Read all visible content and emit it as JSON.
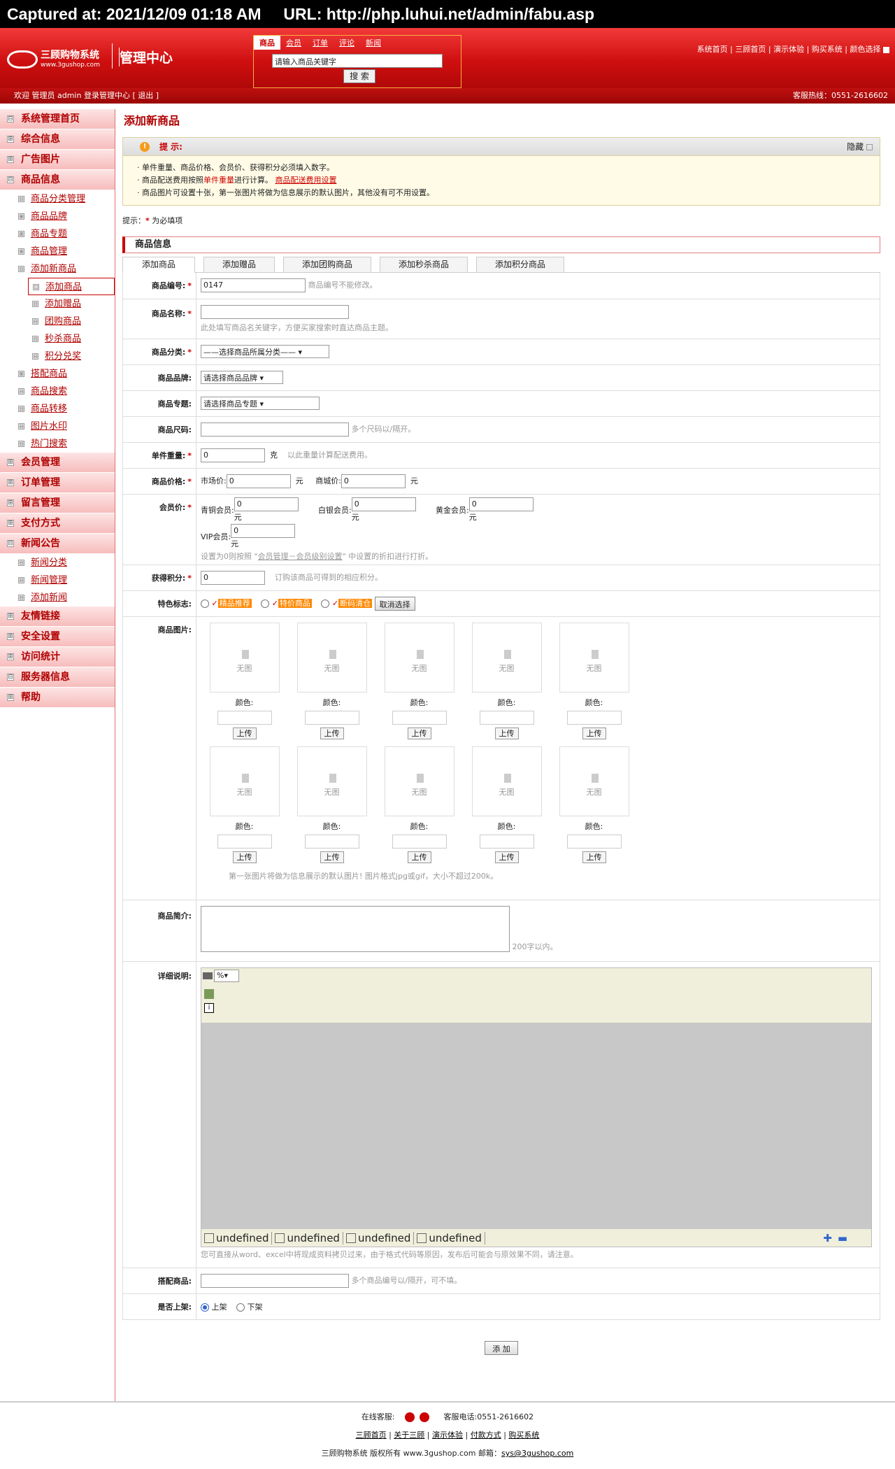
{
  "capture": {
    "text": "Captured at: 2021/12/09 01:18 AM     URL: http://php.luhui.net/admin/fabu.asp"
  },
  "header": {
    "brand_cn": "三顾购物系统",
    "brand_en": "www.3gushop.com",
    "title": "管理中心",
    "search_tabs": [
      "商品",
      "会员",
      "订单",
      "评论",
      "新闻"
    ],
    "search_placeholder": "请输入商品关键字",
    "search_button": "搜 索",
    "top_links": [
      "系统首页",
      "三顾首页",
      "演示体验",
      "购买系统",
      "颜色选择"
    ]
  },
  "status_bar": {
    "welcome": "欢迎 管理员 admin 登录管理中心 [ 退出 ]",
    "hotline": "客服热线：0551-2616602"
  },
  "sidebar": {
    "items": [
      {
        "label": "系统管理首页",
        "type": "main",
        "icon": "⊟"
      },
      {
        "label": "综合信息",
        "type": "main",
        "icon": "⊞"
      },
      {
        "label": "广告图片",
        "type": "main",
        "icon": "⊞"
      },
      {
        "label": "商品信息",
        "type": "main",
        "icon": "⊟"
      },
      {
        "label": "商品分类管理",
        "type": "sub",
        "icon": "⊟"
      },
      {
        "label": "商品品牌",
        "type": "sub",
        "icon": "⊞"
      },
      {
        "label": "商品专题",
        "type": "sub",
        "icon": "⊞"
      },
      {
        "label": "商品管理",
        "type": "sub",
        "icon": "⊞"
      },
      {
        "label": "添加新商品",
        "type": "sub",
        "icon": "⊟"
      },
      {
        "label": "添加商品",
        "type": "sel",
        "icon": "⊡"
      },
      {
        "label": "添加赠品",
        "type": "l3",
        "icon": "⊟"
      },
      {
        "label": "团购商品",
        "type": "l3",
        "icon": "⊟"
      },
      {
        "label": "秒杀商品",
        "type": "l3",
        "icon": "⊟"
      },
      {
        "label": "积分兑奖",
        "type": "l3",
        "icon": "⊟"
      },
      {
        "label": "搭配商品",
        "type": "sub",
        "icon": "⊞"
      },
      {
        "label": "商品搜索",
        "type": "sub",
        "icon": "⊟"
      },
      {
        "label": "商品转移",
        "type": "sub",
        "icon": "⊟"
      },
      {
        "label": "图片水印",
        "type": "sub",
        "icon": "⊟"
      },
      {
        "label": "热门搜索",
        "type": "sub",
        "icon": "⊟"
      },
      {
        "label": "会员管理",
        "type": "main",
        "icon": "⊞"
      },
      {
        "label": "订单管理",
        "type": "main",
        "icon": "⊞"
      },
      {
        "label": "留言管理",
        "type": "main",
        "icon": "⊞"
      },
      {
        "label": "支付方式",
        "type": "main",
        "icon": "⊞"
      },
      {
        "label": "新闻公告",
        "type": "main",
        "icon": "⊟"
      },
      {
        "label": "新闻分类",
        "type": "sub",
        "icon": "⊟"
      },
      {
        "label": "新闻管理",
        "type": "sub",
        "icon": "⊟"
      },
      {
        "label": "添加新闻",
        "type": "sub",
        "icon": "⊟"
      },
      {
        "label": "友情链接",
        "type": "main",
        "icon": "⊞"
      },
      {
        "label": "安全设置",
        "type": "main",
        "icon": "⊞"
      },
      {
        "label": "访问统计",
        "type": "main",
        "icon": "⊞"
      },
      {
        "label": "服务器信息",
        "type": "main",
        "icon": "⊟"
      },
      {
        "label": "帮助",
        "type": "main",
        "icon": "⊞"
      }
    ]
  },
  "main": {
    "page_title": "添加新商品",
    "tip": {
      "title": "提 示:",
      "hide": "隐藏",
      "line1": "· 单件重量、商品价格、会员价、获得积分必须填入数字。",
      "line2_a": "· 商品配送费用按照",
      "line2_b": "单件重量",
      "line2_c": "进行计算。",
      "line2_link": "商品配送费用设置",
      "line3": "· 商品图片可设置十张，第一张图片将做为信息展示的默认图片，其他没有可不用设置。"
    },
    "required_note_a": "提示：",
    "required_note_star": "*",
    "required_note_b": " 为必填项",
    "section": "商品信息",
    "tabs": [
      "添加商品",
      "添加赠品",
      "添加团购商品",
      "添加秒杀商品",
      "添加积分商品"
    ],
    "fields": {
      "code_label": "商品编号:",
      "code_value": "0147",
      "code_hint": "商品编号不能修改。",
      "name_label": "商品名称:",
      "name_hint": "此处填写商品名关键字，方便买家搜索时直达商品主题。",
      "cat_label": "商品分类:",
      "cat_value": "——选择商品所属分类——",
      "brand_label": "商品品牌:",
      "brand_value": "请选择商品品牌",
      "topic_label": "商品专题:",
      "topic_value": "请选择商品专题",
      "size_label": "商品尺码:",
      "size_hint": "多个尺码以/隔开。",
      "weight_label": "单件重量:",
      "weight_value": "0",
      "weight_unit": "克",
      "weight_hint": "以此重量计算配送费用。",
      "price_label": "商品价格:",
      "market_label": "市场价:",
      "market_value": "0",
      "yuan": "元",
      "shop_label": "商城价:",
      "shop_value": "0",
      "member_label": "会员价:",
      "m1_label": "青铜会员:",
      "m1_value": "0",
      "m2_label": "白银会员:",
      "m2_value": "0",
      "m3_label": "黄金会员:",
      "m3_value": "0",
      "m4_label": "VIP会员:",
      "m4_value": "0",
      "member_hint_a": "设置为0则按照 \"",
      "member_hint_link": "会员管理－会员级别设置",
      "member_hint_b": "\" 中设置的折扣进行打折。",
      "points_label": "获得积分:",
      "points_value": "0",
      "points_hint": "订购该商品可得到的相应积分。",
      "feature_label": "特色标志:",
      "feat1": "精品推荐",
      "feat2": "特价商品",
      "feat3": "断码清仓",
      "feat_cancel": "取消选择",
      "pic_label": "商品图片:",
      "pic_none": "无图",
      "pic_color": "颜色:",
      "pic_upload": "上传",
      "pic_hint": "第一张图片将做为信息展示的默认图片! 图片格式jpg或gif，大小不超过200k。",
      "intro_label": "商品简介:",
      "intro_hint": "200字以内。",
      "detail_label": "详细说明:",
      "detail_zoom": "%",
      "editor_tabs": [
        "undefined",
        "undefined",
        "undefined",
        "undefined"
      ],
      "detail_hint": "您可直接从word、excel中将现成资料拷贝过来，由于格式代码等原因，发布后可能会与原效果不同，请注意。",
      "match_label": "搭配商品:",
      "match_hint": "多个商品编号以/隔开，可不填。",
      "shelf_label": "是否上架:",
      "shelf_on": "上架",
      "shelf_off": "下架",
      "submit": "添 加"
    }
  },
  "footer": {
    "online": "在线客服:",
    "phone": "客服电话:0551-2616602",
    "links": [
      "三顾首页",
      "关于三顾",
      "演示体验",
      "付款方式",
      "购买系统"
    ],
    "copy_a": "三顾购物系统 版权所有 www.3gushop.com 邮箱：",
    "copy_mail": "sys@3gushop.com"
  }
}
